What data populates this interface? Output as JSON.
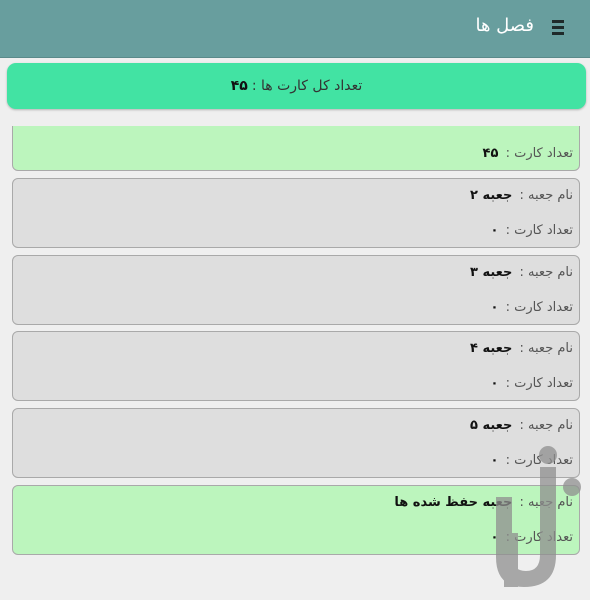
{
  "app_bar": {
    "title": "فصل ها",
    "menu_icon": "hamburger-menu-icon"
  },
  "total": {
    "label": "تعداد کل کارت ها :",
    "value": "۴۵"
  },
  "labels": {
    "box_name": "نام جعبه :",
    "card_count": "تعداد کارت :"
  },
  "boxes": [
    {
      "name": "",
      "count": "۴۵",
      "highlighted": true
    },
    {
      "name": "جعبه ۲",
      "count": "۰",
      "highlighted": false
    },
    {
      "name": "جعبه ۳",
      "count": "۰",
      "highlighted": false
    },
    {
      "name": "جعبه ۴",
      "count": "۰",
      "highlighted": false
    },
    {
      "name": "جعبه ۵",
      "count": "۰",
      "highlighted": false
    },
    {
      "name": "جعبه حفظ شده ها",
      "count": "۰",
      "highlighted": true
    }
  ],
  "colors": {
    "app_bar": "#689e9e",
    "total_banner": "#42e3a3",
    "box_highlight": "#bcf5bd",
    "box_default": "#dedede"
  }
}
